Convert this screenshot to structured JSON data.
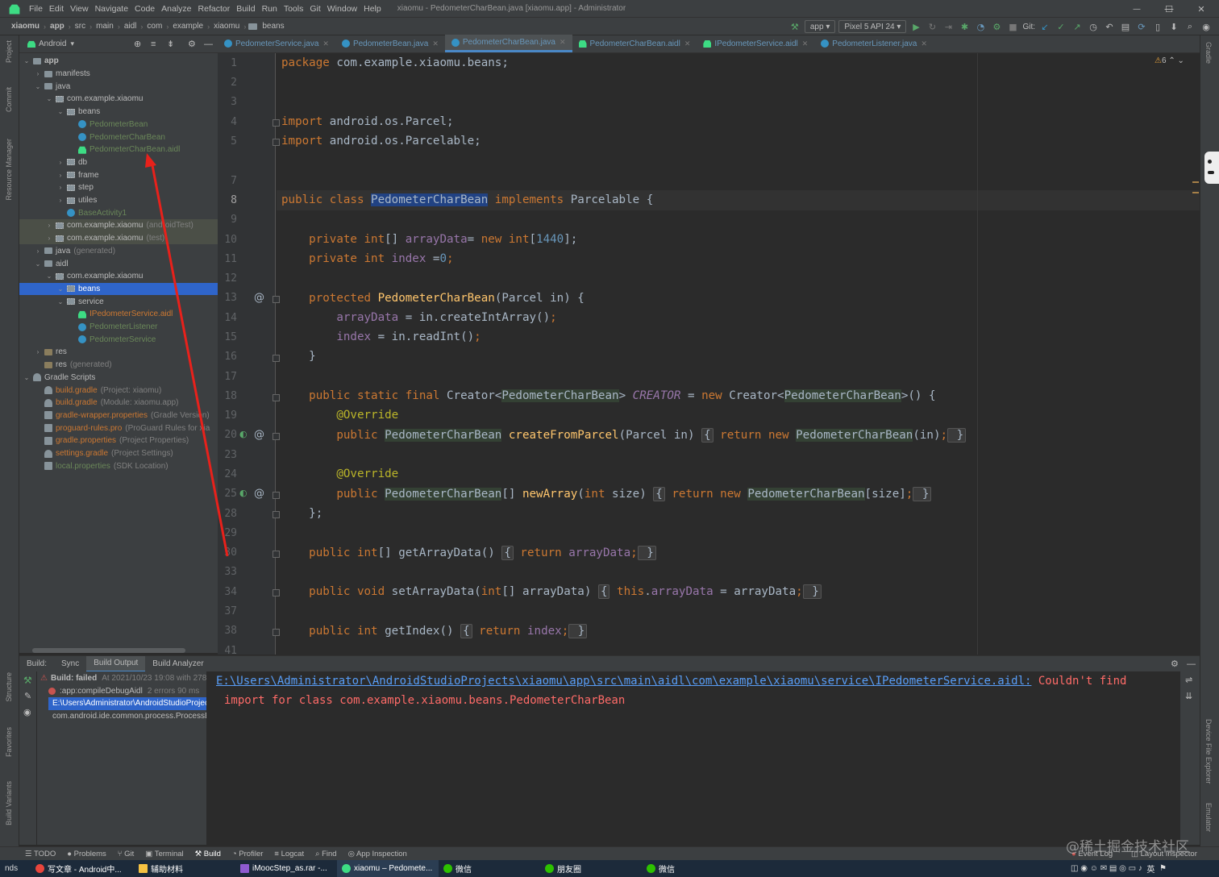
{
  "menubar": {
    "items": [
      "File",
      "Edit",
      "View",
      "Navigate",
      "Code",
      "Analyze",
      "Refactor",
      "Build",
      "Run",
      "Tools",
      "Git",
      "Window",
      "Help"
    ],
    "title": "xiaomu - PedometerCharBean.java [xiaomu.app] - Administrator",
    "minimize": "—",
    "maximize": "☐",
    "close": "✕"
  },
  "navbar": {
    "crumbs": [
      "xiaomu",
      "app",
      "src",
      "main",
      "aidl",
      "com",
      "example",
      "xiaomu",
      "beans"
    ]
  },
  "runtoolbar": {
    "config": "app",
    "device": "Pixel 5 API 24",
    "git_label": "Git:"
  },
  "left_strip": {
    "labels": [
      "Project",
      "Commit",
      "Resource Manager",
      "Structure",
      "Favorites",
      "Build Variants"
    ]
  },
  "right_strip": {
    "labels": [
      "Gradle",
      "Device File Explorer",
      "Emulator"
    ]
  },
  "project_tool": {
    "view": "Android"
  },
  "tree": [
    {
      "label": "app",
      "level": 0,
      "arrow": "⌄",
      "icon": "folder",
      "bold": true
    },
    {
      "label": "manifests",
      "level": 1,
      "arrow": "›",
      "icon": "folder"
    },
    {
      "label": "java",
      "level": 1,
      "arrow": "⌄",
      "icon": "folder"
    },
    {
      "label": "com.example.xiaomu",
      "level": 2,
      "arrow": "⌄",
      "icon": "pkg"
    },
    {
      "label": "beans",
      "level": 3,
      "arrow": "⌄",
      "icon": "pkg"
    },
    {
      "label": "PedometerBean",
      "level": 4,
      "arrow": "",
      "icon": "cls",
      "cls": "g"
    },
    {
      "label": "PedometerCharBean",
      "level": 4,
      "arrow": "",
      "icon": "cls",
      "cls": "g"
    },
    {
      "label": "PedometerCharBean.aidl",
      "level": 4,
      "arrow": "",
      "icon": "aidl",
      "cls": "g"
    },
    {
      "label": "db",
      "level": 3,
      "arrow": "›",
      "icon": "pkg"
    },
    {
      "label": "frame",
      "level": 3,
      "arrow": "›",
      "icon": "pkg"
    },
    {
      "label": "step",
      "level": 3,
      "arrow": "›",
      "icon": "pkg"
    },
    {
      "label": "utiles",
      "level": 3,
      "arrow": "›",
      "icon": "pkg"
    },
    {
      "label": "BaseActivity1",
      "level": 3,
      "arrow": "",
      "icon": "cls",
      "cls": "g"
    },
    {
      "label": "com.example.xiaomu",
      "suffix": "(androidTest)",
      "level": 2,
      "arrow": "›",
      "icon": "pkg",
      "row": "hl"
    },
    {
      "label": "com.example.xiaomu",
      "suffix": "(test)",
      "level": 2,
      "arrow": "›",
      "icon": "pkg",
      "row": "hl"
    },
    {
      "label": "java",
      "suffix": "(generated)",
      "level": 1,
      "arrow": "›",
      "icon": "folder"
    },
    {
      "label": "aidl",
      "level": 1,
      "arrow": "⌄",
      "icon": "folder"
    },
    {
      "label": "com.example.xiaomu",
      "level": 2,
      "arrow": "⌄",
      "icon": "pkg"
    },
    {
      "label": "beans",
      "level": 3,
      "arrow": "⌄",
      "icon": "pkg",
      "row": "sel"
    },
    {
      "label": "service",
      "level": 3,
      "arrow": "⌄",
      "icon": "pkg"
    },
    {
      "label": "IPedometerService.aidl",
      "level": 4,
      "arrow": "",
      "icon": "aidl",
      "cls": "o"
    },
    {
      "label": "PedometerListener",
      "level": 4,
      "arrow": "",
      "icon": "cls",
      "cls": "g"
    },
    {
      "label": "PedometerService",
      "level": 4,
      "arrow": "",
      "icon": "cls",
      "cls": "g"
    },
    {
      "label": "res",
      "level": 1,
      "arrow": "›",
      "icon": "res"
    },
    {
      "label": "res",
      "suffix": "(generated)",
      "level": 1,
      "arrow": "",
      "icon": "res"
    },
    {
      "label": "Gradle Scripts",
      "level": 0,
      "arrow": "⌄",
      "icon": "gradle"
    },
    {
      "label": "build.gradle",
      "suffix": "(Project: xiaomu)",
      "level": 1,
      "arrow": "",
      "icon": "gradle",
      "cls": "o"
    },
    {
      "label": "build.gradle",
      "suffix": "(Module: xiaomu.app)",
      "level": 1,
      "arrow": "",
      "icon": "gradle",
      "cls": "o"
    },
    {
      "label": "gradle-wrapper.properties",
      "suffix": "(Gradle Version)",
      "level": 1,
      "arrow": "",
      "icon": "prop",
      "cls": "o"
    },
    {
      "label": "proguard-rules.pro",
      "suffix": "(ProGuard Rules for xia",
      "level": 1,
      "arrow": "",
      "icon": "prop",
      "cls": "o"
    },
    {
      "label": "gradle.properties",
      "suffix": "(Project Properties)",
      "level": 1,
      "arrow": "",
      "icon": "prop",
      "cls": "o"
    },
    {
      "label": "settings.gradle",
      "suffix": "(Project Settings)",
      "level": 1,
      "arrow": "",
      "icon": "gradle",
      "cls": "o"
    },
    {
      "label": "local.properties",
      "suffix": "(SDK Location)",
      "level": 1,
      "arrow": "",
      "icon": "prop",
      "cls": "g"
    }
  ],
  "tabs": [
    {
      "label": "PedometerService.java",
      "icon": "cls"
    },
    {
      "label": "PedometerBean.java",
      "icon": "cls"
    },
    {
      "label": "PedometerCharBean.java",
      "icon": "cls",
      "active": true
    },
    {
      "label": "PedometerCharBean.aidl",
      "icon": "aidl"
    },
    {
      "label": "IPedometerService.aidl",
      "icon": "aidl"
    },
    {
      "label": "PedometerListener.java",
      "icon": "cls"
    }
  ],
  "editor": {
    "warnings": "6",
    "line_numbers": [
      "1",
      "2",
      "3",
      "4",
      "5",
      "7",
      "8",
      "9",
      "10",
      "11",
      "12",
      "13",
      "14",
      "15",
      "16",
      "17",
      "18",
      "19",
      "20",
      "23",
      "24",
      "25",
      "28",
      "29",
      "30",
      "33",
      "34",
      "37",
      "38",
      "41"
    ],
    "current_line": "8",
    "code": {
      "l1_kw": "package",
      "l1_rest": " com.example.xiaomu.beans;",
      "l4_kw": "import",
      "l4_rest": " android.os.Parcel;",
      "l5_kw": "import",
      "l5_rest": " android.os.Parcelable;",
      "l8_kw": "public class ",
      "l8_cls": "PedometerCharBean",
      "l8_kw2": " implements ",
      "l8_rest": "Parcelable {",
      "l10_kw": "    private int",
      "l10_rest": "[] ",
      "l10_fld": "arrayData",
      "l10_eq": "= ",
      "l10_kw2": "new int",
      "l10_br": "[",
      "l10_num": "1440",
      "l10_end": "];",
      "l11_kw": "    private int ",
      "l11_fld": "index ",
      "l11_eq": "=",
      "l11_num": "0",
      "l11_end": ";",
      "l13_kw": "    protected ",
      "l13_fn": "PedometerCharBean",
      "l13_rest": "(Parcel in) {",
      "l14_fld": "        arrayData",
      "l14_rest": " = in.createIntArray()",
      "l14_end": ";",
      "l15_fld": "        index",
      "l15_rest": " = in.readInt()",
      "l15_end": ";",
      "l16": "    }",
      "l18_kw": "    public static final ",
      "l18_r1": "Creator<",
      "l18_c1": "PedometerCharBean",
      "l18_r2": "> ",
      "l18_it": "CREATOR",
      "l18_r3": " = ",
      "l18_kw2": "new ",
      "l18_r4": "Creator<",
      "l18_c2": "PedometerCharBean",
      "l18_r5": ">() {",
      "l19_ann": "        @Override",
      "l20_kw": "        public ",
      "l20_c1": "PedometerCharBean",
      "l20_fn": " createFromParcel",
      "l20_r1": "(Parcel in) ",
      "l20_f1": "{",
      "l20_kw2": " return new ",
      "l20_c2": "PedometerCharBean",
      "l20_r2": "(in)",
      "l20_semi": ";",
      "l20_f2": " }",
      "l24_ann": "        @Override",
      "l25_kw": "        public ",
      "l25_c1": "PedometerCharBean",
      "l25_r1": "[] ",
      "l25_fn": "newArray",
      "l25_r2": "(",
      "l25_kw2": "int ",
      "l25_r3": "size) ",
      "l25_f1": "{",
      "l25_kw3": " return new ",
      "l25_c2": "PedometerCharBean",
      "l25_r4": "[size]",
      "l25_semi": ";",
      "l25_f2": " }",
      "l28": "    };",
      "l30_kw": "    public int",
      "l30_r1": "[] getArrayData() ",
      "l30_f1": "{",
      "l30_kw2": " return ",
      "l30_fld": "arrayData",
      "l30_semi": ";",
      "l30_f2": " }",
      "l34_kw": "    public void ",
      "l34_r1": "setArrayData(",
      "l34_kw2": "int",
      "l34_r2": "[] arrayData) ",
      "l34_f1": "{",
      "l34_kw3": " this",
      "l34_r3": ".",
      "l34_fld": "arrayData",
      "l34_r4": " = arrayData",
      "l34_semi": ";",
      "l34_f2": " }",
      "l38_kw": "    public int ",
      "l38_r1": "getIndex() ",
      "l38_f1": "{",
      "l38_kw2": " return ",
      "l38_fld": "index",
      "l38_semi": ";",
      "l38_f2": " }"
    }
  },
  "build": {
    "label": "Build:",
    "tabs": [
      "Sync",
      "Build Output",
      "Build Analyzer"
    ],
    "active_tab": "Build Output",
    "rows": [
      {
        "text": "Build: failed",
        "time": "At 2021/10/23 19:08 with 278 ms"
      },
      {
        "text": ":app:compileDebugAidl",
        "time": "2 errors    90 ms"
      },
      {
        "text": "E:\\Users\\Administrator\\AndroidStudioProjects\\xiaomu",
        "time": ""
      },
      {
        "text": "com.android.ide.common.process.ProcessException",
        "time": ""
      }
    ],
    "output_link": "E:\\Users\\Administrator\\AndroidStudioProjects\\xiaomu\\app\\src\\main\\aidl\\com\\example\\xiaomu\\service\\IPedometerService.aidl:",
    "output_err1": " Couldn't find",
    "output_err2": "import for class com.example.xiaomu.beans.PedometerCharBean"
  },
  "bottombar": {
    "items": [
      "TODO",
      "Problems",
      "Git",
      "Terminal",
      "Build",
      "Profiler",
      "Logcat",
      "Find",
      "App Inspection"
    ],
    "right": [
      "Event Log",
      "Layout Inspector"
    ]
  },
  "taskbar": {
    "left": "nds",
    "items": [
      {
        "label": "写文章 - Android中...",
        "color": "#e8453c"
      },
      {
        "label": "辅助材料",
        "color": "#f5c242"
      },
      {
        "label": "iMoocStep_as.rar -...",
        "color": "#8e5bd0"
      },
      {
        "label": "xiaomu – Pedomete...",
        "color": "#3ddc84"
      },
      {
        "label": "微信",
        "color": "#2dc100"
      },
      {
        "label": "朋友圈",
        "color": "#2dc100"
      },
      {
        "label": "微信",
        "color": "#2dc100"
      }
    ],
    "tray": "英"
  },
  "watermark": "@稀土掘金技术社区",
  "colors": {
    "accent": "#4a88c7",
    "selection": "#2f65ca",
    "error": "#ff6b68",
    "link": "#589df6",
    "annotation_arrow": "#e8211b"
  }
}
